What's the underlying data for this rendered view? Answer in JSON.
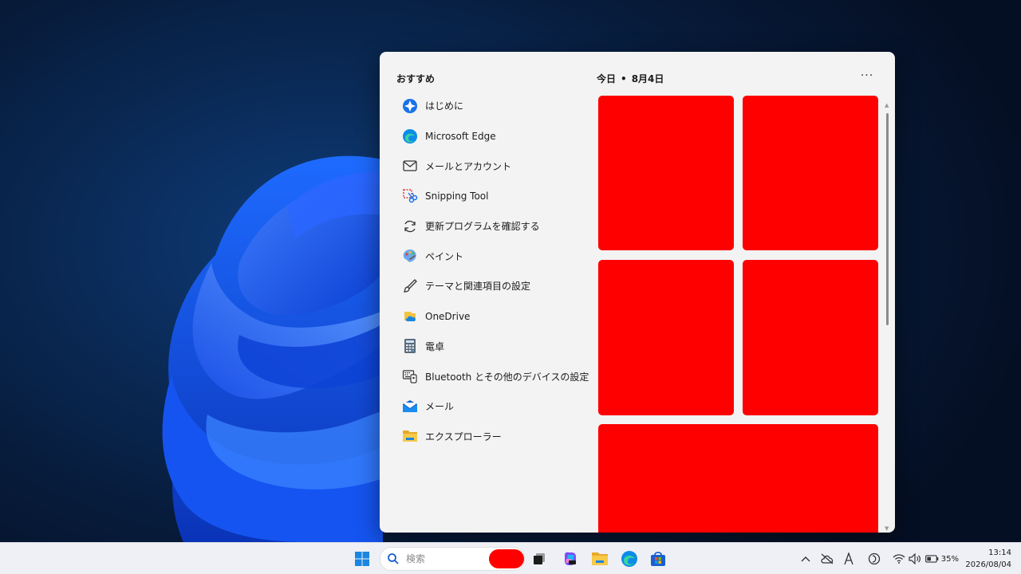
{
  "widgets_panel": {
    "section_title": "おすすめ",
    "date_label": "今日",
    "date_separator": "•",
    "date_value": "8月4日",
    "more_label": "···",
    "apps": [
      {
        "label": "はじめに",
        "icon": "get-started-icon"
      },
      {
        "label": "Microsoft Edge",
        "icon": "edge-icon"
      },
      {
        "label": "メールとアカウント",
        "icon": "mail-outline-icon"
      },
      {
        "label": "Snipping Tool",
        "icon": "snipping-tool-icon"
      },
      {
        "label": "更新プログラムを確認する",
        "icon": "refresh-icon"
      },
      {
        "label": "ペイント",
        "icon": "paint-icon"
      },
      {
        "label": "テーマと関連項目の設定",
        "icon": "brush-icon"
      },
      {
        "label": "OneDrive",
        "icon": "onedrive-icon"
      },
      {
        "label": "電卓",
        "icon": "calculator-icon"
      },
      {
        "label": "Bluetooth とその他のデバイスの設定",
        "icon": "devices-icon"
      },
      {
        "label": "メール",
        "icon": "mail-app-icon"
      },
      {
        "label": "エクスプローラー",
        "icon": "file-explorer-icon"
      }
    ],
    "widget_color": "#ff0000"
  },
  "taskbar": {
    "search_placeholder": "検索",
    "pinned": [
      "start-icon",
      "task-view-icon",
      "copilot-icon",
      "file-explorer-icon",
      "edge-icon",
      "store-icon"
    ],
    "tray": {
      "battery_percent": "35%",
      "time": "13:14",
      "date": "2026/08/04"
    }
  }
}
